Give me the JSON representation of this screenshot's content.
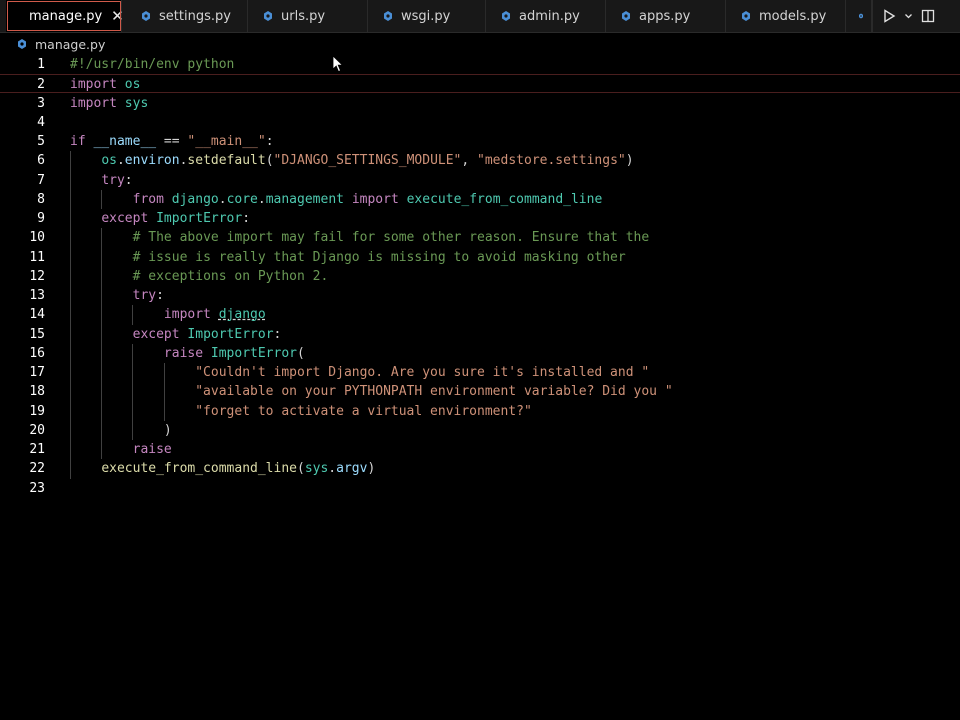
{
  "tabs": [
    {
      "label": "manage.py",
      "active": true,
      "close": "✕"
    },
    {
      "label": "settings.py",
      "active": false
    },
    {
      "label": "urls.py",
      "active": false
    },
    {
      "label": "wsgi.py",
      "active": false
    },
    {
      "label": "admin.py",
      "active": false
    },
    {
      "label": "apps.py",
      "active": false
    },
    {
      "label": "models.py",
      "active": false
    }
  ],
  "breadcrumb": {
    "file": "manage.py"
  },
  "colors": {
    "keyword": "#c586c0",
    "builtin_keyword": "#569cd6",
    "string": "#ce9178",
    "comment": "#6a9955",
    "function": "#dcdcaa",
    "class": "#4ec9b0",
    "variable": "#9cdcfe",
    "python_icon": "#4a8fd6"
  },
  "icons": {
    "file": "python-file-icon",
    "run": "play-icon",
    "split": "split-editor-icon",
    "cursor": "mouse-pointer-icon"
  },
  "code": {
    "lines": [
      "#!/usr/bin/env python",
      "import os",
      "import sys",
      "",
      "if __name__ == \"__main__\":",
      "    os.environ.setdefault(\"DJANGO_SETTINGS_MODULE\", \"medstore.settings\")",
      "    try:",
      "        from django.core.management import execute_from_command_line",
      "    except ImportError:",
      "        # The above import may fail for some other reason. Ensure that the",
      "        # issue is really that Django is missing to avoid masking other",
      "        # exceptions on Python 2.",
      "        try:",
      "            import django",
      "        except ImportError:",
      "            raise ImportError(",
      "                \"Couldn't import Django. Are you sure it's installed and \"",
      "                \"available on your PYTHONPATH environment variable? Did you \"",
      "                \"forget to activate a virtual environment?\"",
      "            )",
      "        raise",
      "    execute_from_command_line(sys.argv)",
      ""
    ],
    "current_line": 2
  }
}
